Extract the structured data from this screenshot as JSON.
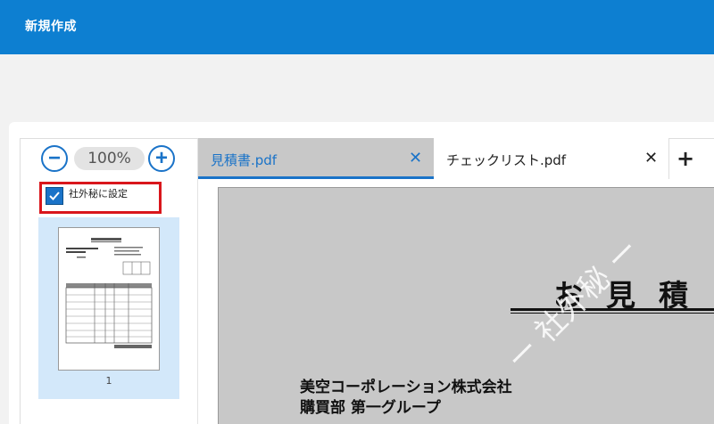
{
  "header": {
    "title": "新規作成"
  },
  "zoom": {
    "value": "100%",
    "minus_symbol": "−",
    "plus_symbol": "+"
  },
  "confidential": {
    "label": "社外秘に設定",
    "checked": true
  },
  "thumbnails": [
    {
      "page_number": "1"
    }
  ],
  "tabs": [
    {
      "label": "見積書.pdf",
      "active": true,
      "close_symbol": "✕"
    },
    {
      "label": "チェックリスト.pdf",
      "active": false,
      "close_symbol": "✕"
    }
  ],
  "add_tab": {
    "symbol": "+"
  },
  "document": {
    "title": "お見積",
    "company": "美空コーポレーション株式会社",
    "department": "購買部 第一グループ",
    "watermark": "ー 社外秘 ー"
  },
  "colors": {
    "brand": "#0d7fd1",
    "accent": "#1a73c8",
    "highlight": "#d9161c",
    "selection": "#d3e8fa"
  }
}
